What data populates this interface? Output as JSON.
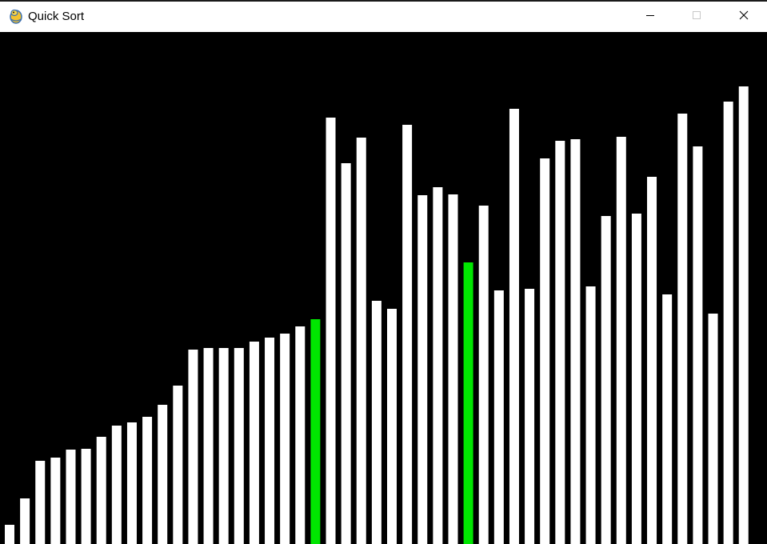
{
  "window": {
    "title": "Quick Sort",
    "icon": "pygame-snake-icon",
    "controls": {
      "minimize_icon": "minimize-icon",
      "maximize_icon": "maximize-icon",
      "close_icon": "close-icon"
    }
  },
  "colors": {
    "background": "#000000",
    "bar": "#ffffff",
    "highlight": "#00e600"
  },
  "chart_data": {
    "type": "bar",
    "title": "",
    "xlabel": "",
    "ylabel": "",
    "ylim": [
      0,
      640
    ],
    "values": [
      24,
      57,
      104,
      108,
      118,
      119,
      134,
      148,
      152,
      159,
      174,
      198,
      243,
      245,
      245,
      245,
      253,
      258,
      263,
      272,
      281,
      533,
      476,
      508,
      304,
      294,
      524,
      436,
      446,
      437,
      352,
      423,
      317,
      544,
      319,
      482,
      504,
      506,
      322,
      410,
      509,
      413,
      459,
      312,
      538,
      497,
      288,
      553,
      572
    ],
    "highlighted_indices": [
      20,
      30
    ]
  }
}
